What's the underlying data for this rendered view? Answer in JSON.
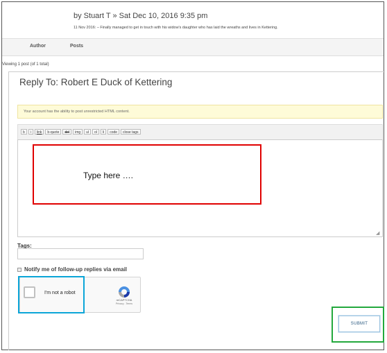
{
  "post": {
    "byline": "by Stuart T » Sat Dec 10, 2016 9:35 pm",
    "excerpt": "11 Nov 2016: – Finally managed to get in touch with his widow's daughter who has laid the wreaths and lives in Kettering."
  },
  "table_header": {
    "author": "Author",
    "posts": "Posts"
  },
  "viewing": "Viewing 1 post (of 1 total)",
  "reply": {
    "title": "Reply To: Robert E Duck of Kettering",
    "notice": "Your account has the ability to post unrestricted HTML content."
  },
  "toolbar": {
    "buttons": [
      "b",
      "i",
      "link",
      "b-quote",
      "del",
      "img",
      "ul",
      "ol",
      "li",
      "code",
      "close tags"
    ]
  },
  "editor": {
    "annotation": "Type here …."
  },
  "tags": {
    "label": "Tags:",
    "value": ""
  },
  "notify": {
    "label": "Notify me of follow-up replies via email"
  },
  "captcha": {
    "label": "I'm not a robot",
    "brand": "reCAPTCHA",
    "terms": "Privacy - Terms"
  },
  "submit": {
    "label": "SUBMIT"
  },
  "colors": {
    "annotation_red": "#e00000",
    "annotation_blue": "#0aa5d8",
    "annotation_green": "#22a83c"
  }
}
